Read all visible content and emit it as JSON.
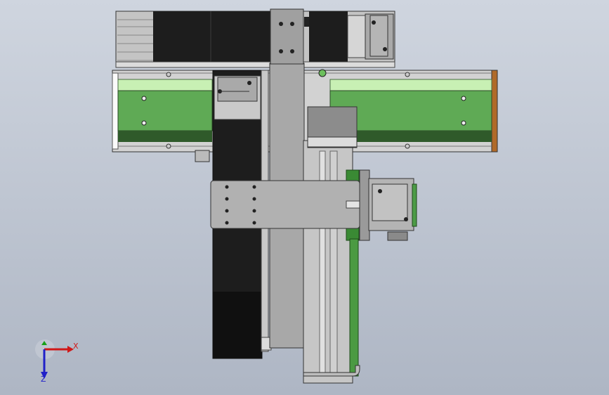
{
  "triad": {
    "x_label": "X",
    "z_label": "Z",
    "x_color": "#d01818",
    "y_color": "#18a018",
    "z_color": "#2020c8"
  },
  "colors": {
    "background_top": "#cfd5df",
    "background_bottom": "#aeb6c4",
    "belt_green": "#5faa55",
    "belt_dark": "#2f5a2a",
    "belt_light": "#c8f0b4",
    "black_module": "#1d1d1d",
    "plate_gray": "#a8a8a8",
    "frame_gray": "#bfbfbf"
  }
}
